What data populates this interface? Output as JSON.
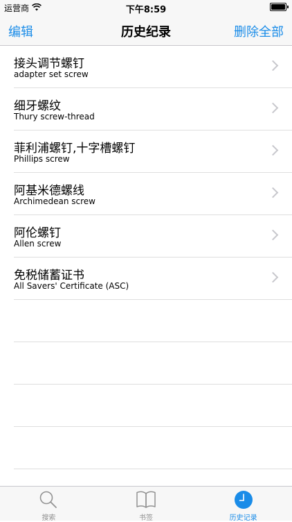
{
  "status_bar": {
    "carrier": "运营商",
    "time": "下午8:59"
  },
  "nav": {
    "edit_label": "编辑",
    "title": "历史纪录",
    "delete_all_label": "删除全部"
  },
  "history": [
    {
      "title": "接头调节螺钉",
      "subtitle": "adapter set screw"
    },
    {
      "title": "细牙螺纹",
      "subtitle": "Thury screw-thread"
    },
    {
      "title": "菲利浦螺钉,十字槽螺钉",
      "subtitle": "Phillips screw"
    },
    {
      "title": "阿基米德螺线",
      "subtitle": "Archimedean screw"
    },
    {
      "title": "阿伦螺钉",
      "subtitle": "Allen screw"
    },
    {
      "title": "免税储蓄证书",
      "subtitle": "All Savers' Certificate (ASC)"
    }
  ],
  "tabs": [
    {
      "label": "搜索",
      "icon": "search-icon"
    },
    {
      "label": "书签",
      "icon": "book-icon"
    },
    {
      "label": "历史记录",
      "icon": "clock-icon"
    }
  ],
  "colors": {
    "accent": "#1a8ce8",
    "inactive_tab": "#929292"
  }
}
